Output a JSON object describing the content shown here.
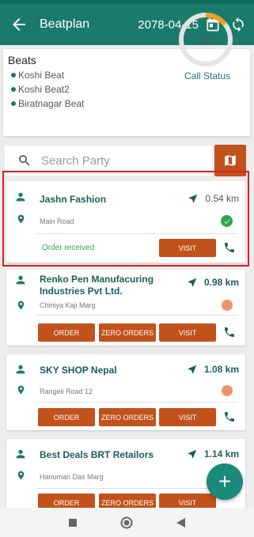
{
  "app": {
    "title": "Beatplan",
    "date": "2078-04-15"
  },
  "beats": {
    "heading": "Beats",
    "items": [
      "Koshi Beat",
      "Koshi Beat2",
      "Biratnagar Beat"
    ],
    "call_status_label": "Call Status",
    "call_status_value": "1/7",
    "call_status_progress": 0.143
  },
  "search": {
    "placeholder": "Search Party"
  },
  "buttons": {
    "order": "ORDER",
    "zero_orders": "ZERO ORDERS",
    "visit": "VISIT"
  },
  "parties": [
    {
      "name": "Jashn Fashion",
      "distance": "0.54 km",
      "address": "Main Road",
      "status": "Order received"
    },
    {
      "name": "Renko Pen Manufacuring Industries Pvt Ltd.",
      "distance": "0.98 km",
      "address": "Chiniya Kaji Marg"
    },
    {
      "name": "SKY SHOP Nepal",
      "distance": "1.08 km",
      "address": "Rangeli Road 12"
    },
    {
      "name": "Best Deals BRT Retailors",
      "distance": "1.14 km",
      "address": "Hanuman Das Marg"
    }
  ],
  "colors": {
    "primary": "#1a7a6b",
    "accent": "#c1521c",
    "ring_progress": "#f0a020",
    "highlight": "#e01b1b"
  },
  "fab": {
    "label": "+"
  }
}
